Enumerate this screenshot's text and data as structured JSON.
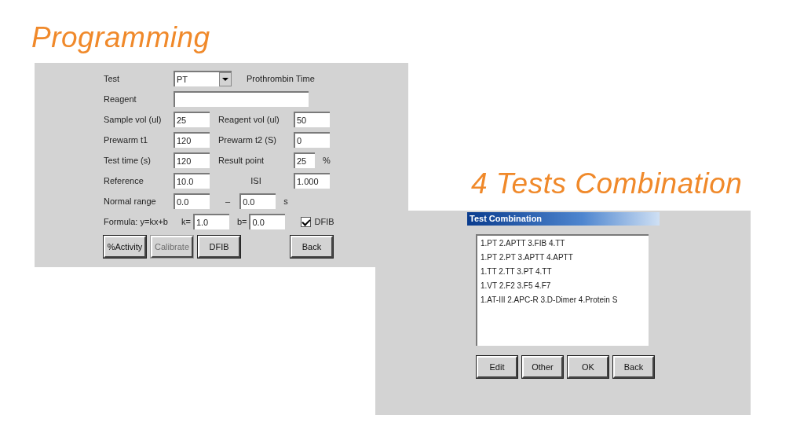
{
  "programming": {
    "heading": "Programming",
    "rows": [
      [
        {
          "kind": "label",
          "text": "Test"
        },
        {
          "kind": "select",
          "value": "PT"
        },
        {
          "kind": "label",
          "text": "Prothrombin Time"
        }
      ],
      [
        {
          "kind": "label",
          "text": "Reagent"
        },
        {
          "kind": "wide_field"
        }
      ],
      [
        {
          "kind": "label",
          "text": "Sample vol (ul)"
        },
        {
          "kind": "field",
          "value": "25"
        },
        {
          "kind": "label",
          "text": "Reagent vol (ul)"
        },
        {
          "kind": "field",
          "value": "50"
        }
      ],
      [
        {
          "kind": "label",
          "text": "Prewarm t1"
        },
        {
          "kind": "field",
          "value": "120"
        },
        {
          "kind": "label",
          "text": "Prewarm t2 (S)"
        },
        {
          "kind": "field",
          "value": "0"
        }
      ],
      [
        {
          "kind": "label",
          "text": "Test time (s)"
        },
        {
          "kind": "field",
          "value": "120"
        },
        {
          "kind": "label",
          "text": "Result point"
        },
        {
          "kind": "short_field",
          "value": "25",
          "unit": "%"
        }
      ],
      [
        {
          "kind": "label",
          "text": "Reference"
        },
        {
          "kind": "field",
          "value": "10.0"
        },
        {
          "kind": "caption",
          "text": "ISI"
        },
        {
          "kind": "field",
          "value": "1.000"
        }
      ],
      [
        {
          "kind": "label",
          "text": "Normal range"
        },
        {
          "kind": "field",
          "value": "0.0"
        },
        {
          "kind": "dash",
          "text": "–"
        },
        {
          "kind": "field",
          "value": "0.0",
          "unit": "s"
        }
      ],
      [
        {
          "kind": "label",
          "text": "Formula: y=kx+b"
        },
        {
          "kind": "prefix",
          "text": "k="
        },
        {
          "kind": "field",
          "value": "1.0"
        },
        {
          "kind": "prefix",
          "text": "b="
        },
        {
          "kind": "field",
          "value": "0.0"
        },
        {
          "kind": "check",
          "text": "DFIB",
          "checked": true
        }
      ]
    ],
    "buttons": [
      {
        "label": "%Activity",
        "disabled": false
      },
      {
        "label": "Calibrate",
        "disabled": true
      },
      {
        "label": "DFIB",
        "disabled": false
      },
      {
        "label": "Back",
        "disabled": false
      }
    ]
  },
  "combination": {
    "heading": "4 Tests Combination",
    "dialog_title": "Test Combination",
    "items": [
      "1.PT 2.APTT 3.FIB 4.TT",
      "1.PT 2.PT 3.APTT 4.APTT",
      "1.TT 2.TT 3.PT 4.TT",
      "1.VT 2.F2 3.F5 4.F7",
      "1.AT-III 2.APC-R 3.D-Dimer 4.Protein S"
    ],
    "buttons": [
      "Edit",
      "Other",
      "OK",
      "Back"
    ]
  }
}
